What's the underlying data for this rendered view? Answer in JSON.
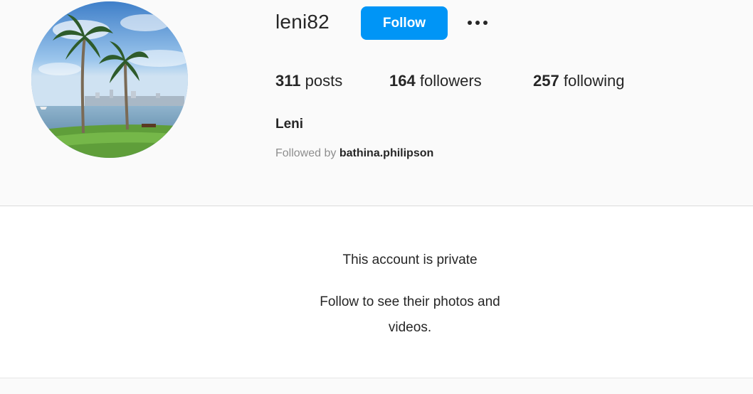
{
  "profile": {
    "username": "leni82",
    "follow_label": "Follow",
    "more_icon": "more-horizontal-icon",
    "stats": {
      "posts_count": "311",
      "posts_label": "posts",
      "followers_count": "164",
      "followers_label": "followers",
      "following_count": "257",
      "following_label": "following"
    },
    "full_name": "Leni",
    "followed_by_prefix": "Followed by",
    "followed_by_name": "bathina.philipson"
  },
  "private_notice": {
    "title": "This account is private",
    "subtitle": "Follow to see their photos and videos."
  },
  "colors": {
    "accent": "#0095f6",
    "text": "#262626",
    "muted": "#8e8e8e",
    "background": "#fafafa"
  }
}
